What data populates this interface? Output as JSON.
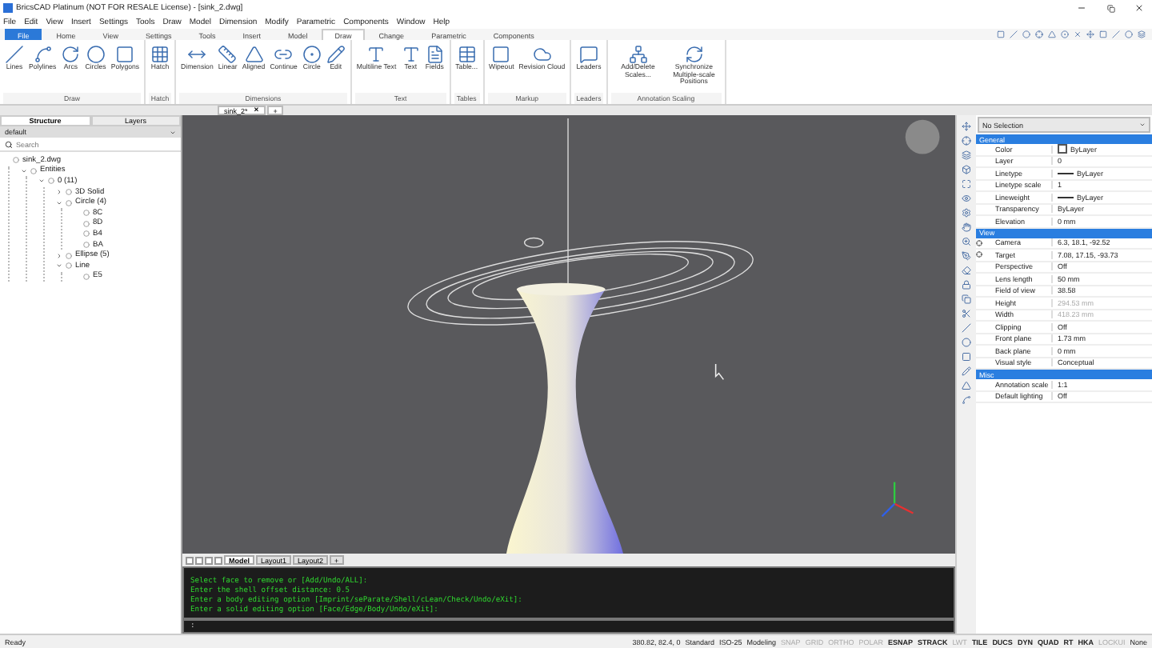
{
  "window": {
    "title": "BricsCAD Platinum (NOT FOR RESALE License) - [sink_2.dwg]"
  },
  "menu": [
    "File",
    "Edit",
    "View",
    "Insert",
    "Settings",
    "Tools",
    "Draw",
    "Model",
    "Dimension",
    "Modify",
    "Parametric",
    "Components",
    "Window",
    "Help"
  ],
  "ribbon_tabs": [
    {
      "label": "File",
      "selected": false,
      "kind": "file"
    },
    {
      "label": "Home",
      "selected": false,
      "kind": "tab"
    },
    {
      "label": "View",
      "selected": false,
      "kind": "tab"
    },
    {
      "label": "Settings",
      "selected": false,
      "kind": "tab"
    },
    {
      "label": "Tools",
      "selected": false,
      "kind": "tab"
    },
    {
      "label": "Insert",
      "selected": false,
      "kind": "tab"
    },
    {
      "label": "Model",
      "selected": false,
      "kind": "tab"
    },
    {
      "label": "Draw",
      "selected": true,
      "kind": "tab"
    },
    {
      "label": "Change",
      "selected": false,
      "kind": "tab"
    },
    {
      "label": "Parametric",
      "selected": false,
      "kind": "tab"
    },
    {
      "label": "Components",
      "selected": false,
      "kind": "tab"
    }
  ],
  "ribbon_groups": [
    {
      "title": "Draw",
      "buttons": [
        "Lines",
        "Polylines",
        "Arcs",
        "Circles",
        "Polygons"
      ]
    },
    {
      "title": "Hatch",
      "buttons": [
        "Hatch"
      ]
    },
    {
      "title": "Dimensions",
      "buttons": [
        "Dimension",
        "Linear",
        "Aligned",
        "Continue",
        "Circle",
        "Edit"
      ]
    },
    {
      "title": "Text",
      "buttons": [
        "Multiline Text",
        "Text",
        "Fields"
      ]
    },
    {
      "title": "Tables",
      "buttons": [
        "Table..."
      ]
    },
    {
      "title": "Markup",
      "buttons": [
        "Wipeout",
        "Revision Cloud"
      ]
    },
    {
      "title": "Leaders",
      "buttons": [
        "Leaders"
      ]
    },
    {
      "title": "Annotation Scaling",
      "buttons": [
        "Add/Delete Scales...",
        "Synchronize Multiple-scale Positions"
      ]
    }
  ],
  "document_tabs": [
    {
      "label": "sink_2*",
      "close": "×"
    },
    {
      "label": "+"
    }
  ],
  "left_panel": {
    "tabs": [
      {
        "label": "Structure",
        "selected": true
      },
      {
        "label": "Layers",
        "selected": false
      }
    ],
    "profile": "default",
    "search": {
      "placeholder": "Search"
    },
    "tree": [
      {
        "label": "sink_2.dwg",
        "children": [
          {
            "label": "Entities",
            "expanded": true,
            "children": [
              {
                "label": "0 (11)",
                "expanded": true,
                "children": [
                  {
                    "label": "3D Solid",
                    "expanded": false
                  },
                  {
                    "label": "Circle (4)",
                    "expanded": true,
                    "children": [
                      {
                        "label": "8C"
                      },
                      {
                        "label": "8D"
                      },
                      {
                        "label": "B4"
                      },
                      {
                        "label": "BA"
                      }
                    ]
                  },
                  {
                    "label": "Ellipse (5)",
                    "expanded": false
                  },
                  {
                    "label": "Line",
                    "expanded": true,
                    "children": [
                      {
                        "label": "E5"
                      }
                    ]
                  }
                ]
              }
            ]
          }
        ]
      }
    ]
  },
  "layout_tabs": [
    {
      "label": "Model",
      "selected": true
    },
    {
      "label": "Layout1",
      "selected": false
    },
    {
      "label": "Layout2",
      "selected": false
    },
    {
      "label": "+",
      "selected": false
    }
  ],
  "command_history": [
    "Select face to remove or [Add/Undo/ALL]:",
    "Enter the shell offset distance: 0.5",
    "Enter a body editing option [Imprint/seParate/Shell/cLean/Check/Undo/eXit]:",
    "Enter a solid editing option [Face/Edge/Body/Undo/eXit]:"
  ],
  "command_prompt": ":",
  "properties": {
    "selection": "No Selection",
    "sections": [
      {
        "title": "General",
        "expanded": true,
        "rows": [
          {
            "name": "Color",
            "value": "ByLayer",
            "kind": "color",
            "disabled": false
          },
          {
            "name": "Layer",
            "value": "0",
            "kind": "text",
            "disabled": false
          },
          {
            "name": "Linetype",
            "value": "ByLayer",
            "kind": "line",
            "disabled": false
          },
          {
            "name": "Linetype scale",
            "value": "1",
            "kind": "text",
            "disabled": false
          },
          {
            "name": "Lineweight",
            "value": "ByLayer",
            "kind": "line",
            "disabled": false
          },
          {
            "name": "Transparency",
            "value": "ByLayer",
            "kind": "text",
            "disabled": false
          },
          {
            "name": "Elevation",
            "value": "0 mm",
            "kind": "text",
            "disabled": false
          }
        ]
      },
      {
        "title": "View",
        "expanded": true,
        "rows": [
          {
            "name": "Camera",
            "value": "6.3, 18.1, -92.52",
            "kind": "pick",
            "disabled": false
          },
          {
            "name": "Target",
            "value": "7.08, 17.15, -93.73",
            "kind": "pick",
            "disabled": false
          },
          {
            "name": "Perspective",
            "value": "Off",
            "kind": "text",
            "disabled": false
          },
          {
            "name": "Lens length",
            "value": "50 mm",
            "kind": "text",
            "disabled": false
          },
          {
            "name": "Field of view",
            "value": "38.58",
            "kind": "text",
            "disabled": false
          },
          {
            "name": "Height",
            "value": "294.53 mm",
            "kind": "text",
            "disabled": true
          },
          {
            "name": "Width",
            "value": "418.23 mm",
            "kind": "text",
            "disabled": true
          },
          {
            "name": "Clipping",
            "value": "Off",
            "kind": "text",
            "disabled": false
          },
          {
            "name": "Front plane",
            "value": "1.73 mm",
            "kind": "text",
            "disabled": false
          },
          {
            "name": "Back plane",
            "value": "0 mm",
            "kind": "text",
            "disabled": false
          },
          {
            "name": "Visual style",
            "value": "Conceptual",
            "kind": "text",
            "disabled": false
          }
        ]
      },
      {
        "title": "Misc",
        "expanded": true,
        "rows": [
          {
            "name": "Annotation scale",
            "value": "1:1",
            "kind": "text",
            "disabled": false
          },
          {
            "name": "Default lighting",
            "value": "Off",
            "kind": "text",
            "disabled": false
          }
        ]
      }
    ]
  },
  "status_bar": {
    "message": "Ready",
    "coordinates": "380.82, 82.4, 0",
    "text_style": "Standard",
    "dim_style": "ISO-25",
    "workspace": "Modeling",
    "toggles": [
      {
        "label": "SNAP",
        "on": false
      },
      {
        "label": "GRID",
        "on": false
      },
      {
        "label": "ORTHO",
        "on": false
      },
      {
        "label": "POLAR",
        "on": false
      },
      {
        "label": "ESNAP",
        "on": true
      },
      {
        "label": "STRACK",
        "on": true
      },
      {
        "label": "LWT",
        "on": false
      },
      {
        "label": "TILE",
        "on": true
      },
      {
        "label": "DUCS",
        "on": true
      },
      {
        "label": "DYN",
        "on": true
      },
      {
        "label": "QUAD",
        "on": true
      },
      {
        "label": "RT",
        "on": true
      },
      {
        "label": "HKA",
        "on": true
      },
      {
        "label": "LOCKUI",
        "on": false
      }
    ],
    "annotation": "None"
  }
}
